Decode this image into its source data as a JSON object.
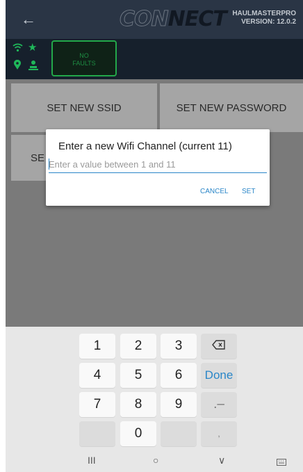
{
  "header": {
    "back_icon": "arrow-left-icon",
    "logo_part1": "CON",
    "logo_part2": "NECT",
    "app_name": "HAULMASTERPRO",
    "version": "VERSION: 12.0.2",
    "faults_line1": "NO",
    "faults_line2": "FAULTS"
  },
  "status_icons": [
    "wifi-icon",
    "star-icon",
    "location-pin-icon",
    "user-icon"
  ],
  "tiles": {
    "set_ssid": "SET NEW SSID",
    "set_password": "SET NEW PASSWORD",
    "partial": "SE"
  },
  "dialog": {
    "title": "Enter a new Wifi Channel (current 11)",
    "placeholder": "Enter a value between 1 and 11",
    "cancel": "CANCEL",
    "set": "SET"
  },
  "keyboard": {
    "row1": [
      "1",
      "2",
      "3"
    ],
    "row2": [
      "4",
      "5",
      "6"
    ],
    "row3": [
      "7",
      "8",
      "9"
    ],
    "zero": "0",
    "done": "Done",
    "minus": ".–",
    "comma": ",",
    "backspace_icon": "backspace-icon"
  },
  "navbar": {
    "recents": "III",
    "home": "○",
    "back": "∨",
    "keyboard_icon": "keyboard-icon"
  },
  "colors": {
    "accent": "#2a86c8",
    "status_green": "#1fb85a",
    "header_bg": "#16202c"
  }
}
